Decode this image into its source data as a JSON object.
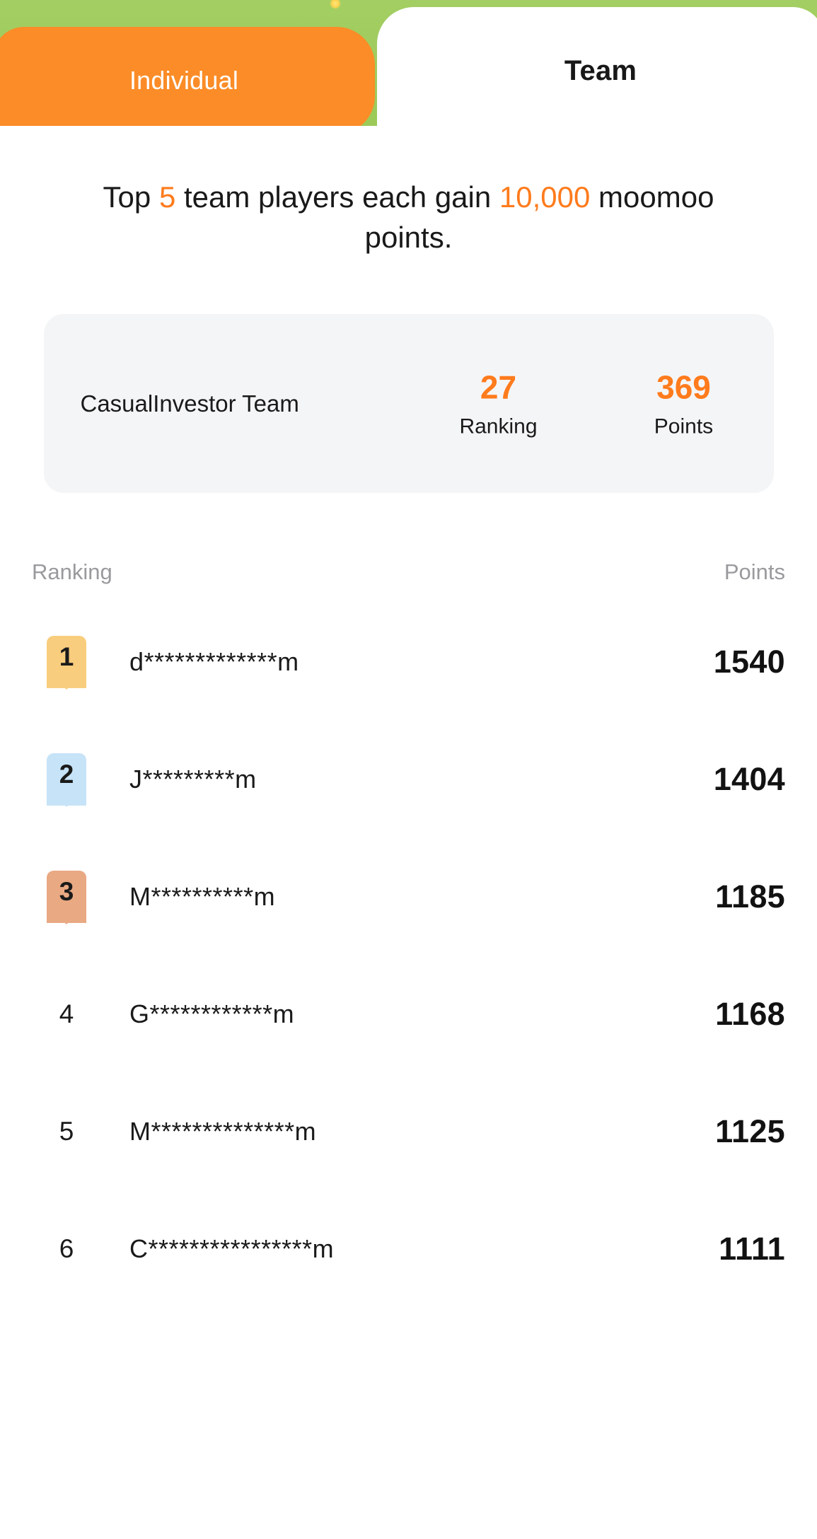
{
  "banner": {
    "background_color": "#9ccc5a",
    "sparkle_icon": "sparkle-dot-icon"
  },
  "tabs": {
    "individual_label": "Individual",
    "team_label": "Team",
    "active": "Team",
    "active_color": "#ffffff",
    "inactive_color": "#fb8c27"
  },
  "promo": {
    "prefix": "Top ",
    "top_count": "5",
    "middle": " team players each gain ",
    "points_amount": "10,000",
    "suffix": " moomoo points.",
    "highlight_color": "#ff7b1c"
  },
  "team_card": {
    "team_name": "CasualInvestor Team",
    "ranking_value": "27",
    "ranking_label": "Ranking",
    "points_value": "369",
    "points_label": "Points",
    "value_color": "#ff7b1c",
    "background_color": "#f4f5f7"
  },
  "list": {
    "header_rank": "Ranking",
    "header_points": "Points",
    "rows": [
      {
        "rank": "1",
        "name": "d*************m",
        "points": "1540",
        "badge": "gold",
        "badge_color": "#f8cd7d"
      },
      {
        "rank": "2",
        "name": "J*********m",
        "points": "1404",
        "badge": "silver",
        "badge_color": "#c6e3f7"
      },
      {
        "rank": "3",
        "name": "M**********m",
        "points": "1185",
        "badge": "bronze",
        "badge_color": "#e9a983"
      },
      {
        "rank": "4",
        "name": "G************m",
        "points": "1168",
        "badge": "none",
        "badge_color": ""
      },
      {
        "rank": "5",
        "name": "M**************m",
        "points": "1125",
        "badge": "none",
        "badge_color": ""
      },
      {
        "rank": "6",
        "name": "C****************m",
        "points": "1111",
        "badge": "none",
        "badge_color": ""
      }
    ]
  }
}
